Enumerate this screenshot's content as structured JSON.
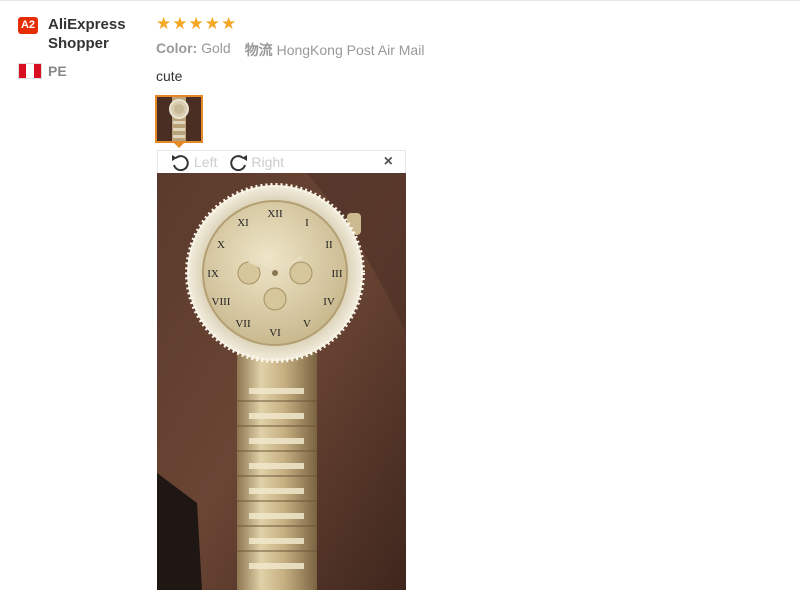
{
  "reviewer": {
    "badge": "A2",
    "name": "AliExpress Shopper",
    "country_code": "PE"
  },
  "review": {
    "rating": 5,
    "color_label": "Color:",
    "color_value": "Gold",
    "logistics_label": "物流",
    "logistics_value": "HongKong Post Air Mail",
    "comment": "cute"
  },
  "viewer": {
    "rotate_left_label": "Left",
    "rotate_right_label": "Right",
    "close_label": "×"
  },
  "colors": {
    "accent": "#e68a29",
    "star": "#f5a623",
    "badge": "#e62e04"
  }
}
